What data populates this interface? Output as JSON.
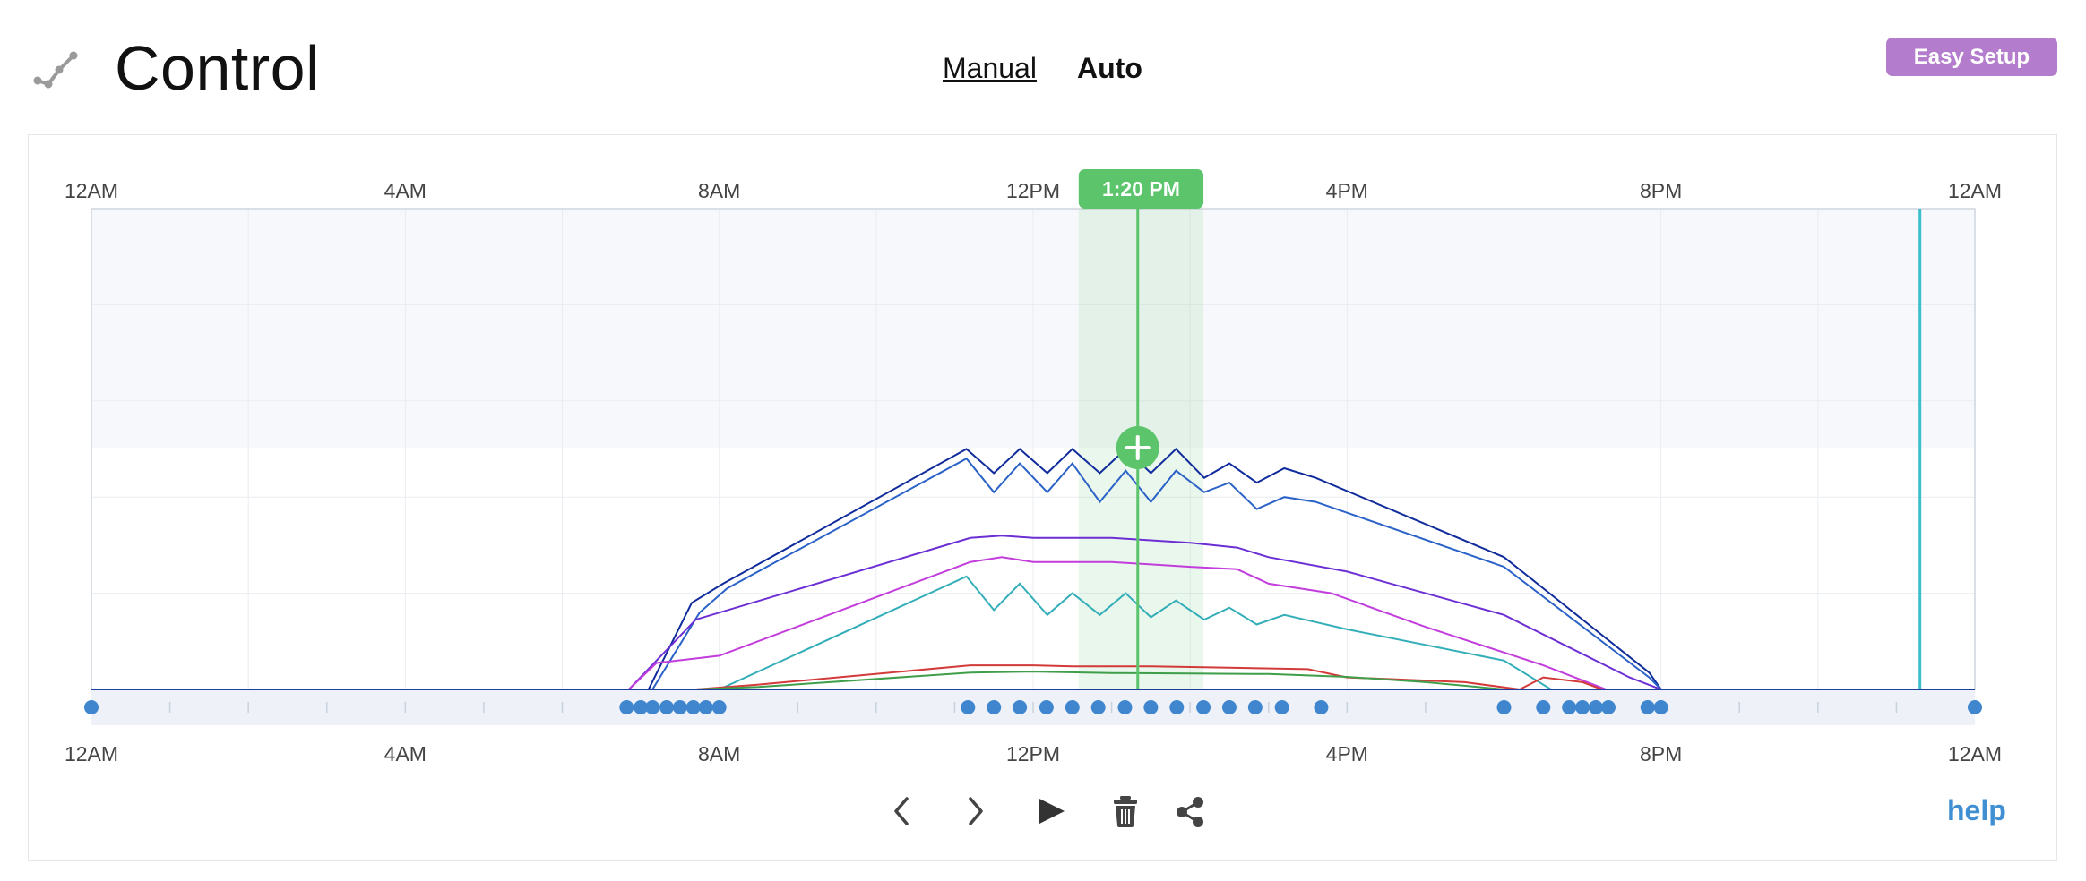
{
  "header": {
    "title": "Control",
    "logo_icon": "line-chart-icon",
    "modes": {
      "manual_label": "Manual",
      "auto_label": "Auto",
      "active": "Auto"
    },
    "easy_setup_label": "Easy Setup"
  },
  "colors": {
    "accent_green": "#5cc46a",
    "easy_setup_purple": "#b47ccc",
    "help_blue": "#3f8fd2",
    "keyframe_blue": "#3f86cf",
    "marker_cyan": "#3bbfcc"
  },
  "chart_data": {
    "type": "line",
    "x_unit": "hours",
    "xlim": [
      0,
      24
    ],
    "ylim": [
      0,
      100
    ],
    "x_tick_labels": [
      "12AM",
      "4AM",
      "8AM",
      "12PM",
      "4PM",
      "8PM",
      "12AM"
    ],
    "x_tick_hours": [
      0,
      4,
      8,
      12,
      16,
      20,
      24
    ],
    "now_label": "1:20 PM",
    "now_hour": 13.333,
    "now_window_hours": [
      12.58,
      14.17
    ],
    "marker_hour": 23.3,
    "grid": true,
    "series": [
      {
        "color": "#102c9c",
        "x": [
          0,
          7.1,
          7.65,
          8.05,
          11.15,
          11.5,
          11.83,
          12.18,
          12.5,
          12.85,
          13.18,
          13.5,
          13.82,
          14.18,
          14.5,
          14.85,
          15.2,
          15.6,
          18.0,
          19.85,
          20.0,
          24
        ],
        "y": [
          0,
          0,
          18,
          22,
          50,
          45,
          50,
          45,
          50,
          45,
          50,
          45,
          50,
          44,
          47,
          43,
          46,
          44,
          27.5,
          3.5,
          0,
          0
        ]
      },
      {
        "color": "#2a62c8",
        "x": [
          0,
          7.15,
          7.75,
          8.1,
          11.15,
          11.5,
          11.83,
          12.18,
          12.5,
          12.85,
          13.18,
          13.5,
          13.82,
          14.18,
          14.5,
          14.85,
          15.2,
          15.6,
          18.0,
          19.85,
          20.0,
          24
        ],
        "y": [
          0,
          0,
          16,
          21,
          48,
          41,
          47,
          41,
          47,
          39,
          45.5,
          39,
          45.5,
          41,
          43,
          37.5,
          40,
          39,
          25.5,
          2.5,
          0,
          0
        ]
      },
      {
        "color": "#6c2fd4",
        "x": [
          0,
          6.85,
          7.7,
          11.2,
          11.6,
          12.0,
          12.6,
          13.0,
          13.5,
          14.0,
          14.6,
          15.0,
          16.0,
          18.0,
          19.6,
          20.0,
          24
        ],
        "y": [
          0,
          0,
          14.5,
          31.5,
          32,
          31.5,
          31.5,
          31.5,
          31,
          30.5,
          29.5,
          27.5,
          24.5,
          15.5,
          2.5,
          0,
          0
        ]
      },
      {
        "color": "#c23ddc",
        "x": [
          0,
          6.85,
          7.2,
          8.0,
          11.2,
          11.6,
          12.0,
          12.6,
          13.0,
          13.5,
          14.0,
          14.6,
          15.0,
          15.8,
          17.0,
          18.5,
          19.3,
          24
        ],
        "y": [
          0,
          0,
          5.5,
          7,
          26.5,
          27.5,
          26.5,
          26.5,
          26.5,
          26,
          25.5,
          25,
          22,
          20,
          13,
          5,
          0,
          0
        ]
      },
      {
        "color": "#33aeb8",
        "x": [
          0,
          8.0,
          11.15,
          11.5,
          11.83,
          12.18,
          12.5,
          12.85,
          13.18,
          13.5,
          13.82,
          14.18,
          14.5,
          14.85,
          15.2,
          15.6,
          16.0,
          18.0,
          18.6,
          24
        ],
        "y": [
          0,
          0,
          23.5,
          16.5,
          22,
          15.5,
          20,
          15.5,
          20,
          15,
          18.5,
          14.5,
          17,
          13.5,
          15.5,
          14,
          12.5,
          6,
          0,
          0
        ]
      },
      {
        "color": "#d33a3a",
        "x": [
          0,
          7.7,
          8.5,
          11.2,
          12.0,
          12.5,
          13.5,
          14.5,
          15.5,
          16.0,
          17.5,
          18.2,
          18.5,
          19.0,
          19.25,
          24
        ],
        "y": [
          0,
          0,
          1,
          5,
          5,
          4.8,
          4.8,
          4.5,
          4.2,
          2.5,
          1.5,
          0,
          2.5,
          1.5,
          0,
          0
        ]
      },
      {
        "color": "#3f9e4a",
        "x": [
          0,
          7.7,
          8.5,
          11.2,
          12.0,
          13.0,
          14.0,
          15.0,
          16.0,
          17.0,
          18.0,
          24
        ],
        "y": [
          0,
          0,
          0.5,
          3.5,
          3.7,
          3.4,
          3.3,
          3.2,
          2.6,
          1.5,
          0,
          0
        ]
      }
    ],
    "keyframes_hours": [
      0,
      6.82,
      7.0,
      7.15,
      7.33,
      7.5,
      7.67,
      7.83,
      8.0,
      11.17,
      11.5,
      11.83,
      12.17,
      12.5,
      12.83,
      13.17,
      13.5,
      13.83,
      14.17,
      14.5,
      14.83,
      15.17,
      15.67,
      18.0,
      18.5,
      18.83,
      19.0,
      19.17,
      19.33,
      19.83,
      20.0,
      24
    ]
  },
  "toolbar": {
    "prev_icon": "chevron-left-icon",
    "next_icon": "chevron-right-icon",
    "play_icon": "play-icon",
    "delete_icon": "trash-icon",
    "share_icon": "share-icon"
  },
  "help_label": "help"
}
